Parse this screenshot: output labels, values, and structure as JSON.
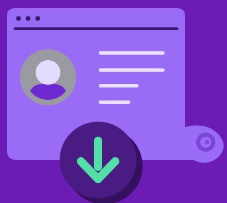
{
  "illustration": {
    "icons": {
      "window_dots": "three-dots-icon",
      "avatar": "user-avatar-icon",
      "text_lines": "text-lines-icon",
      "scroll_curl": "scroll-curl-icon",
      "download": "download-arrow-icon"
    },
    "colors": {
      "background": "#6a1cb4",
      "card": "#9a6cf6",
      "card_shadow": "#4f168f",
      "title_bar_line": "#3a1870",
      "dots": "#3a1870",
      "text_lines": "#e9e2ff",
      "avatar_ring": "#9a9aa2",
      "avatar_person": "#e3dcff",
      "avatar_body": "#6d2ad0",
      "download_circle": "#4a1b82",
      "download_circle_shadow": "#35105f",
      "download_arrow": "#55dfa8"
    }
  }
}
